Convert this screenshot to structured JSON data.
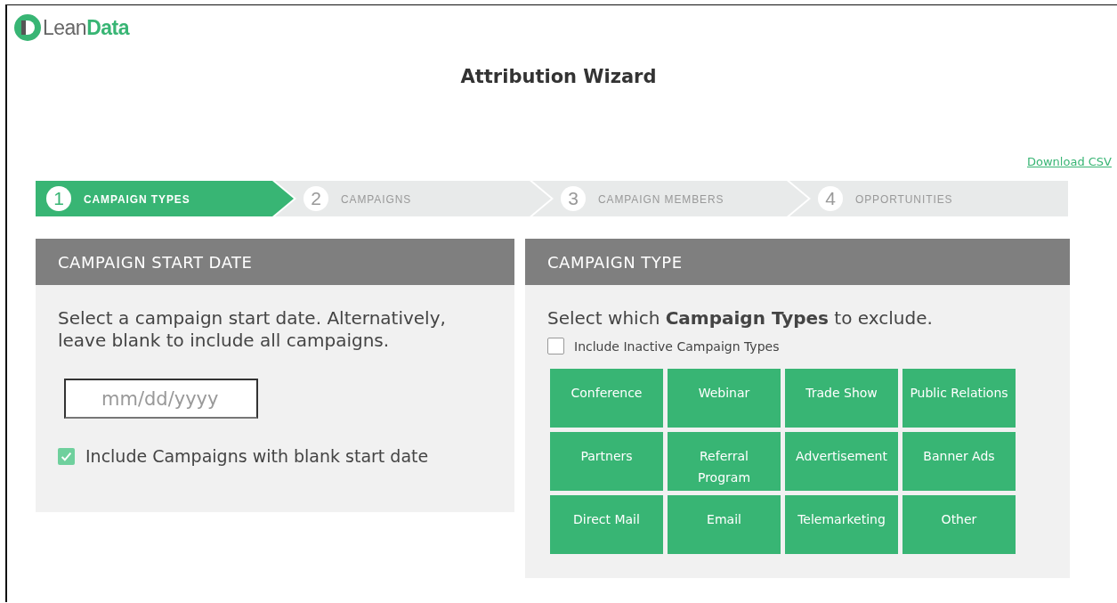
{
  "logo": {
    "text": "Lean**Data**"
  },
  "title": "Attribution Wizard",
  "download_link": "Download CSV",
  "steps": [
    {
      "number": "1",
      "label": "CAMPAIGN TYPES",
      "selected": true
    },
    {
      "number": "2",
      "label": "CAMPAIGNS",
      "selected": false
    },
    {
      "number": "3",
      "label": "CAMPAIGN MEMBERS",
      "selected": false
    },
    {
      "number": "4",
      "label": "OPPORTUNITIES",
      "selected": false
    }
  ],
  "start_date_panel": {
    "header": "CAMPAIGN START DATE",
    "instructions": "Select a campaign start date. Alternatively, leave blank to include all campaigns.",
    "date_field": {
      "placeholder": "mm/dd/yyyy"
    },
    "checkbox": {
      "label": "Include Campaigns with blank start date",
      "checked": true
    }
  },
  "campaign_type_panel": {
    "header": "CAMPAIGN TYPE",
    "instructions": "Select which **Campaign Types** to exclude.",
    "checkbox": {
      "label": "Include Inactive Campaign Types",
      "checked": false
    },
    "types": [
      "Conference",
      "Webinar",
      "Trade Show",
      "Public Relations",
      "Partners",
      "Referral Program",
      "Advertisement",
      "Banner Ads",
      "Direct Mail",
      "Email",
      "Telemarketing",
      "Other"
    ]
  }
}
